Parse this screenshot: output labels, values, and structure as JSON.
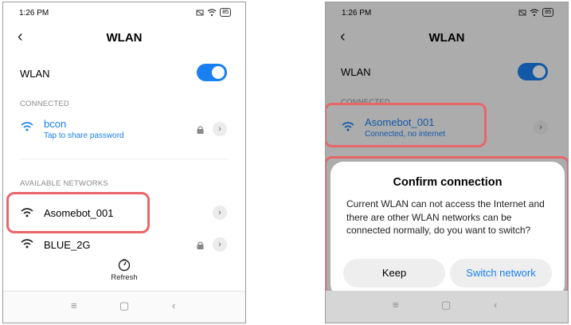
{
  "status_bar": {
    "time": "1:26 PM",
    "battery": "85"
  },
  "screen_left": {
    "back_glyph": "‹",
    "title": "WLAN",
    "wlan_toggle": {
      "label": "WLAN",
      "on": true
    },
    "connected_section": "CONNECTED",
    "connected_network": {
      "name": "bcon",
      "subtitle": "Tap to share password",
      "locked": true
    },
    "available_section": "AVAILABLE NETWORKS",
    "available_networks": [
      {
        "name": "Asomebot_001",
        "locked": false
      },
      {
        "name": "BLUE_2G",
        "locked": true
      }
    ],
    "refresh_label": "Refresh"
  },
  "screen_right": {
    "back_glyph": "‹",
    "title": "WLAN",
    "wlan_toggle": {
      "label": "WLAN",
      "on": true
    },
    "connected_section": "CONNECTED",
    "connected_network": {
      "name": "Asomebot_001",
      "subtitle": "Connected, no internet"
    },
    "dialog": {
      "title": "Confirm connection",
      "message": "Current WLAN can not access the Internet and there are other WLAN networks can be connected normally, do you want to switch?",
      "keep_label": "Keep",
      "switch_label": "Switch network"
    }
  },
  "nav_bar": {
    "menu_glyph": "≡",
    "home_glyph": "▢",
    "back_glyph": "‹"
  },
  "colors": {
    "accent": "#1a7ff0",
    "highlight": "#e8666a",
    "toggle_on": "#1a7ff0"
  },
  "icons": [
    "wifi-icon",
    "lock-icon",
    "chevron-right-icon",
    "refresh-icon",
    "battery-icon",
    "mute-icon"
  ]
}
